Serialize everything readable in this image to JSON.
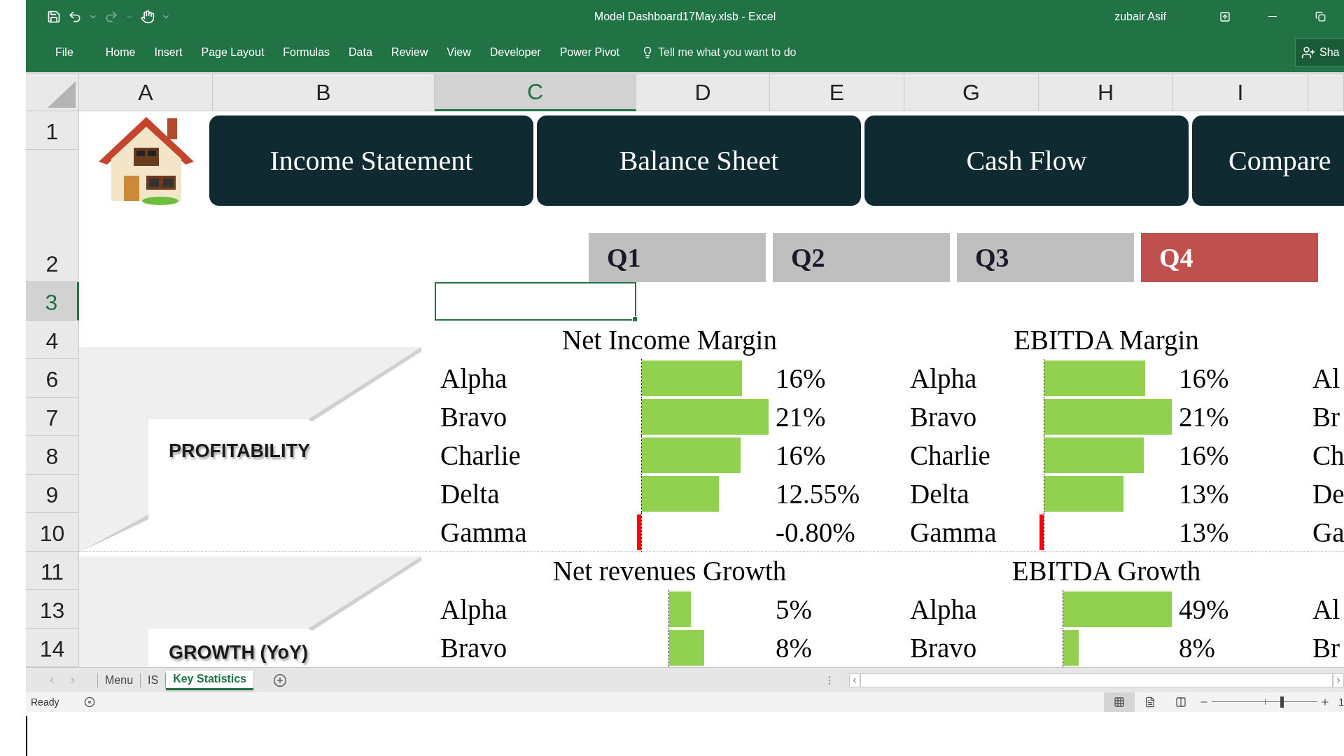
{
  "window": {
    "title": "Model Dashboard17May.xlsb  -  Excel",
    "user": "zubair Asif"
  },
  "ribbon": {
    "tabs": [
      "File",
      "Home",
      "Insert",
      "Page Layout",
      "Formulas",
      "Data",
      "Review",
      "View",
      "Developer",
      "Power Pivot"
    ],
    "tell_me": {
      "placeholder": "Tell me what you want to do"
    },
    "share_button": "Sha"
  },
  "sheet": {
    "columns": [
      {
        "label": "A",
        "selected": false
      },
      {
        "label": "B",
        "selected": false
      },
      {
        "label": "C",
        "selected": true
      },
      {
        "label": "D",
        "selected": false
      },
      {
        "label": "E",
        "selected": false
      },
      {
        "label": "G",
        "selected": false
      },
      {
        "label": "H",
        "selected": false
      },
      {
        "label": "I",
        "selected": false
      }
    ],
    "rows": [
      {
        "label": "1",
        "selected": false
      },
      {
        "label": "2",
        "selected": false
      },
      {
        "label": "3",
        "selected": true
      },
      {
        "label": "4",
        "selected": false
      },
      {
        "label": "6",
        "selected": false
      },
      {
        "label": "7",
        "selected": false
      },
      {
        "label": "8",
        "selected": false
      },
      {
        "label": "9",
        "selected": false
      },
      {
        "label": "10",
        "selected": false
      },
      {
        "label": "11",
        "selected": false
      },
      {
        "label": "13",
        "selected": false
      },
      {
        "label": "14",
        "selected": false
      }
    ],
    "nav_buttons": [
      "Income Statement",
      "Balance Sheet",
      "Cash Flow",
      "Compare"
    ],
    "quarters": [
      {
        "label": "Q1",
        "selected": false
      },
      {
        "label": "Q2",
        "selected": false
      },
      {
        "label": "Q3",
        "selected": false
      },
      {
        "label": "Q4",
        "selected": true
      }
    ],
    "sections": [
      {
        "label": "PROFITABILITY",
        "metrics": [
          {
            "title": "Net Income Margin",
            "items": [
              {
                "name": "Alpha",
                "value": "16%",
                "kind": "positive",
                "level": 0.79
              },
              {
                "name": "Bravo",
                "value": "21%",
                "kind": "positive",
                "level": 1
              },
              {
                "name": "Charlie",
                "value": "16%",
                "kind": "positive",
                "level": 0.78
              },
              {
                "name": "Delta",
                "value": "12.55%",
                "kind": "positive",
                "level": 0.61
              },
              {
                "name": "Gamma",
                "value": "-0.80%",
                "kind": "negative",
                "level": 0.03
              }
            ]
          },
          {
            "title": "EBITDA Margin",
            "items": [
              {
                "name": "Alpha",
                "value": "16%",
                "kind": "positive",
                "level": 0.79
              },
              {
                "name": "Bravo",
                "value": "21%",
                "kind": "positive",
                "level": 1
              },
              {
                "name": "Charlie",
                "value": "16%",
                "kind": "positive",
                "level": 0.78
              },
              {
                "name": "Delta",
                "value": "13%",
                "kind": "positive",
                "level": 0.62
              },
              {
                "name": "Gamma",
                "value": "13%",
                "kind": "negative",
                "level": 0.03
              }
            ]
          }
        ],
        "cut_labels": [
          "Al",
          "Br",
          "Ch",
          "De",
          "Ga"
        ]
      },
      {
        "label": "GROWTH (YoY)",
        "metrics": [
          {
            "title": "Net revenues Growth",
            "items": [
              {
                "name": "Alpha",
                "value": "5%",
                "kind": "positive",
                "level": 0.22
              },
              {
                "name": "Bravo",
                "value": "8%",
                "kind": "positive",
                "level": 0.35
              }
            ]
          },
          {
            "title": "EBITDA Growth",
            "items": [
              {
                "name": "Alpha",
                "value": "49%",
                "kind": "positive",
                "level": 1
              },
              {
                "name": "Bravo",
                "value": "8%",
                "kind": "positive",
                "level": 0.14
              }
            ]
          }
        ],
        "cut_labels": [
          "Al",
          "Br"
        ]
      }
    ]
  },
  "sheet_tabs": [
    {
      "label": "Menu",
      "selected": false
    },
    {
      "label": "IS",
      "selected": false
    },
    {
      "label": "Key Statistics",
      "selected": true
    }
  ],
  "status_bar": {
    "text": "Ready",
    "views": [
      {
        "kind": "normal",
        "selected": true
      },
      {
        "kind": "page_layout",
        "selected": false
      },
      {
        "kind": "page_break",
        "selected": false
      }
    ],
    "zoom": {
      "level": 0.66,
      "reading": "1"
    }
  }
}
